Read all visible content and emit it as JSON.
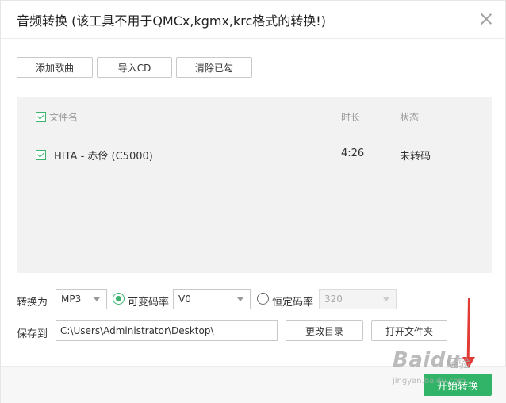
{
  "dialog": {
    "title": "音频转换 (该工具不用于QMCx,kgmx,krc格式的转换!)",
    "close_icon": "close-icon"
  },
  "toolbar": {
    "add_songs": "添加歌曲",
    "import_cd": "导入CD",
    "clear_checked": "清除已勾"
  },
  "file_list": {
    "columns": {
      "filename": "文件名",
      "duration": "时长",
      "status": "状态"
    },
    "select_all_checked": true,
    "rows": [
      {
        "checked": true,
        "filename": "HITA - 赤伶 (C5000)",
        "duration": "4:26",
        "status": "未转码"
      }
    ]
  },
  "convert": {
    "label": "转换为",
    "format": "MP3",
    "vbr_label": "可变码率",
    "vbr_value": "V0",
    "vbr_selected": true,
    "cbr_label": "恒定码率",
    "cbr_value": "320",
    "cbr_selected": false
  },
  "save": {
    "label": "保存到",
    "path": "C:\\Users\\Administrator\\Desktop\\",
    "change_dir": "更改目录",
    "open_folder": "打开文件夹"
  },
  "start_button": "开始转换",
  "watermark": {
    "logo": "Baidu",
    "text": "经验",
    "sub": "jingyan.baidu.com"
  },
  "colors": {
    "accent": "#31b468",
    "annotation_arrow": "#e23b35"
  }
}
